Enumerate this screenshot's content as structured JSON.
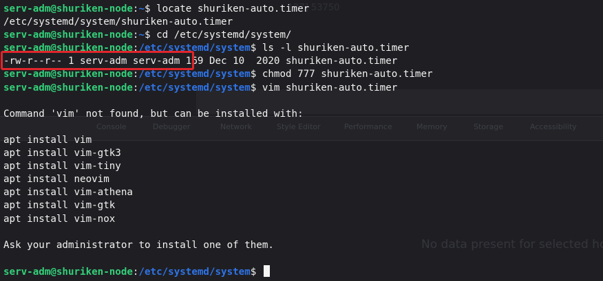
{
  "prompt": {
    "user_host": "serv-adm@shuriken-node",
    "home": "~",
    "dir": "/etc/systemd/system",
    "symbol": "$"
  },
  "lines": {
    "l1_cmd": " locate shuriken-auto.timer",
    "l2_out": "/etc/systemd/system/shuriken-auto.timer",
    "l3_cmd": " cd /etc/systemd/system/",
    "l4_cmd": " ls -l shuriken-auto.timer",
    "l5_perms": "-rw-r--r-- 1 serv-adm serv-adm",
    "l5_rest": " 169 Dec 10  2020 shuriken-auto.timer",
    "l6_cmd": " chmod 777 shuriken-auto.timer",
    "l7_cmd": " vim shuriken-auto.timer",
    "l9_out": "Command 'vim' not found, but can be installed with:",
    "apt": [
      "apt install vim",
      "apt install vim-gtk3",
      "apt install vim-tiny",
      "apt install neovim",
      "apt install vim-athena",
      "apt install vim-gtk",
      "apt install vim-nox"
    ],
    "ask": "Ask your administrator to install one of them."
  },
  "ghost": {
    "tabs": [
      "Console",
      "Debugger",
      "Network",
      "Style Editor",
      "Performance",
      "Memory",
      "Storage",
      "Accessibility"
    ],
    "nodata": "No data present for selected host",
    "num": "127] 53750"
  },
  "colors": {
    "user": "#34d07a",
    "path": "#2f74e8",
    "highlight": "#e0262c",
    "background": "#1f1f23"
  }
}
